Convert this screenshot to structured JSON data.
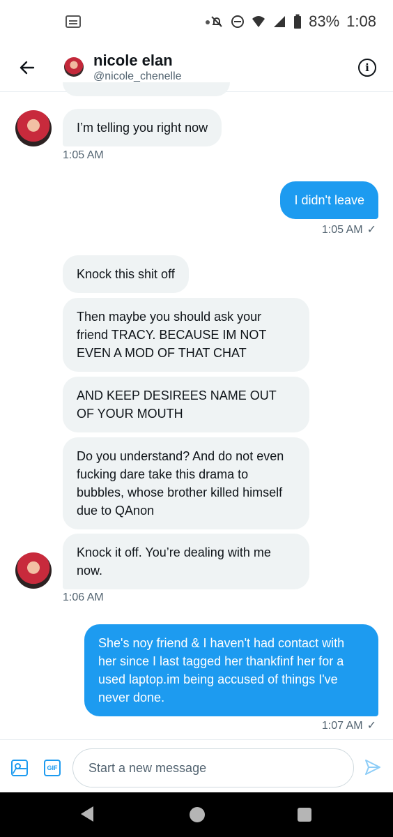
{
  "status_bar": {
    "battery": "83%",
    "time": "1:08"
  },
  "header": {
    "name": "nicole elan",
    "handle": "@nicole_chenelle"
  },
  "messages": [
    {
      "text": "I’m telling you right now",
      "direction": "in"
    },
    {
      "time": "1:05 AM"
    },
    {
      "text": "I didn't leave",
      "direction": "out"
    },
    {
      "time": "1:05 AM"
    },
    {
      "text": "Knock this shit off",
      "direction": "in"
    },
    {
      "text": "Then maybe you should ask your friend TRACY. BECAUSE IM NOT EVEN A MOD OF THAT CHAT",
      "direction": "in"
    },
    {
      "text": "AND KEEP DESIREES NAME OUT OF YOUR MOUTH",
      "direction": "in"
    },
    {
      "text": "Do you understand? And do not even fucking dare take this drama to bubbles, whose brother killed himself due to QAnon",
      "direction": "in"
    },
    {
      "text": "Knock it off. You’re dealing with me now.",
      "direction": "in"
    },
    {
      "time": "1:06 AM"
    },
    {
      "text": "She's noy friend & I haven't had contact with her since I last tagged her thankfinf her for a used laptop.im being accused of things I've never done.",
      "direction": "out"
    },
    {
      "time": "1:07 AM"
    }
  ],
  "compose": {
    "placeholder": "Start a new message",
    "gif_label": "GIF"
  },
  "colors": {
    "accent": "#1d9bf0",
    "incoming_bubble": "#eff3f4"
  },
  "icons": [
    "back-arrow-icon",
    "info-icon",
    "image-icon",
    "gif-icon",
    "send-icon"
  ]
}
